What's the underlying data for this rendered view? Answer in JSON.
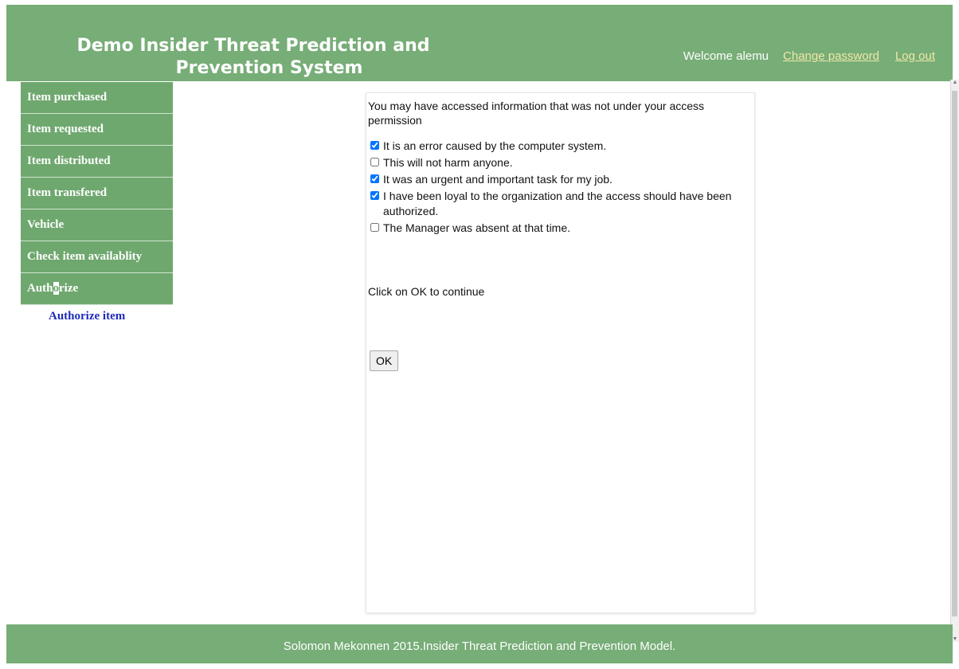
{
  "header": {
    "title_line1": "Demo Insider Threat Prediction and",
    "title_line2": "Prevention System",
    "welcome": "Welcome alemu",
    "change_password": "Change password",
    "log_out": "Log out"
  },
  "sidebar": {
    "items": [
      {
        "label": "Item purchased"
      },
      {
        "label": "Item requested"
      },
      {
        "label": "Item distributed"
      },
      {
        "label": "Item transfered"
      },
      {
        "label": "Vehicle"
      },
      {
        "label": "Check item availablity"
      }
    ],
    "authorize": {
      "pre": "Auth",
      "cursor": "o",
      "post": "rize"
    },
    "submenu": {
      "authorize_item": "Authorize item"
    }
  },
  "panel": {
    "notice": "You may have accessed information that was not under your access permission",
    "reasons": [
      {
        "label": "It is an error caused by the computer system.",
        "checked": true
      },
      {
        "label": "This will not harm anyone.",
        "checked": false
      },
      {
        "label": "It was an urgent and important task for my job.",
        "checked": true
      },
      {
        "label": " I have been loyal to the organization and the access should have been authorized.",
        "checked": true
      },
      {
        "label": "The Manager was absent at that time.",
        "checked": false
      }
    ],
    "continue_text": "Click on OK to continue",
    "ok_label": "OK"
  },
  "footer": {
    "text": "Solomon Mekonnen 2015.Insider Threat Prediction and Prevention Model."
  },
  "colors": {
    "header_green": "#77ad77",
    "menu_green": "#6fa86f",
    "link_yellow": "#f0e9a8",
    "submenu_blue": "#1f2bb8"
  }
}
